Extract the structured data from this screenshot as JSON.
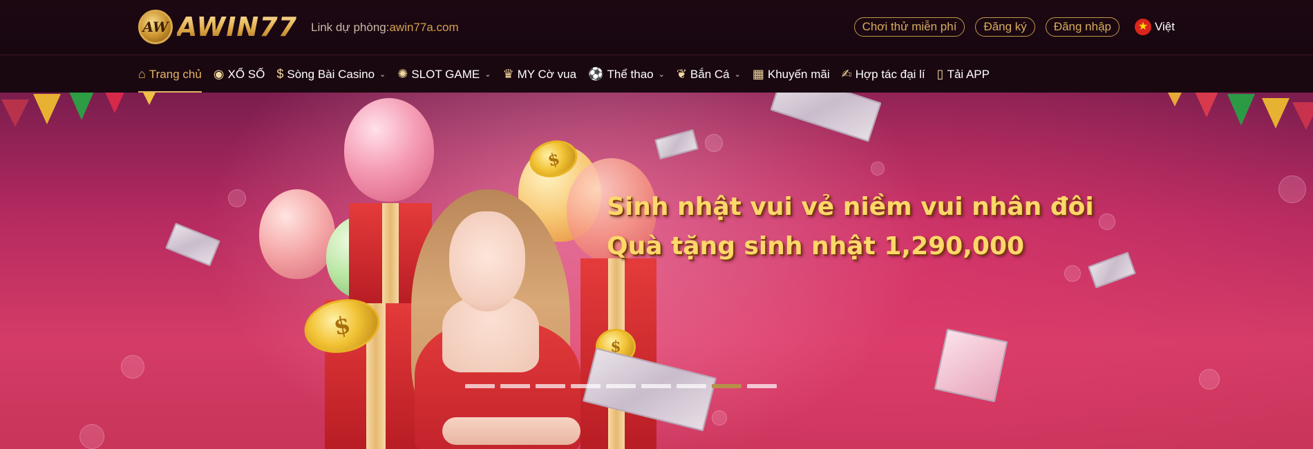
{
  "header": {
    "logo_text": "AWIN77",
    "logo_badge": "AW",
    "backup_link_label": "Link dự phòng:",
    "backup_link_url": "awin77a.com",
    "actions": [
      {
        "label": "Chơi thử miễn phí"
      },
      {
        "label": "Đăng ký"
      },
      {
        "label": "Đăng nhập"
      }
    ],
    "language": {
      "label": "Việt",
      "icon": "vietnam-flag-icon"
    }
  },
  "nav": {
    "items": [
      {
        "label": "Trang chủ",
        "icon": "home-icon",
        "active": true,
        "has_dropdown": false
      },
      {
        "label": "XỔ SỐ",
        "icon": "lottery-ball-icon",
        "active": false,
        "has_dropdown": false
      },
      {
        "label": "Sòng Bài Casino",
        "icon": "casino-chip-icon",
        "active": false,
        "has_dropdown": true
      },
      {
        "label": "SLOT GAME",
        "icon": "slot-wheel-icon",
        "active": false,
        "has_dropdown": true
      },
      {
        "label": "MY Cờ vua",
        "icon": "chess-icon",
        "active": false,
        "has_dropdown": false
      },
      {
        "label": "Thể thao",
        "icon": "soccer-ball-icon",
        "active": false,
        "has_dropdown": true
      },
      {
        "label": "Bắn Cá",
        "icon": "fish-icon",
        "active": false,
        "has_dropdown": true
      },
      {
        "label": "Khuyến mãi",
        "icon": "gift-icon",
        "active": false,
        "has_dropdown": false
      },
      {
        "label": "Hợp tác đại lí",
        "icon": "handshake-icon",
        "active": false,
        "has_dropdown": false
      },
      {
        "label": "Tải APP",
        "icon": "phone-icon",
        "active": false,
        "has_dropdown": false
      }
    ]
  },
  "banner": {
    "headline_1": "Sinh nhật vui vẻ niềm vui nhân đôi",
    "headline_2": "Quà tặng sinh nhật 1,290,000",
    "slides_count": 9,
    "active_slide": 8
  },
  "colors": {
    "accent_gold": "#e2b565",
    "topbar_bg": "#1d0812",
    "banner_pink": "#c8345a",
    "headline_yellow": "#ffd76a"
  }
}
